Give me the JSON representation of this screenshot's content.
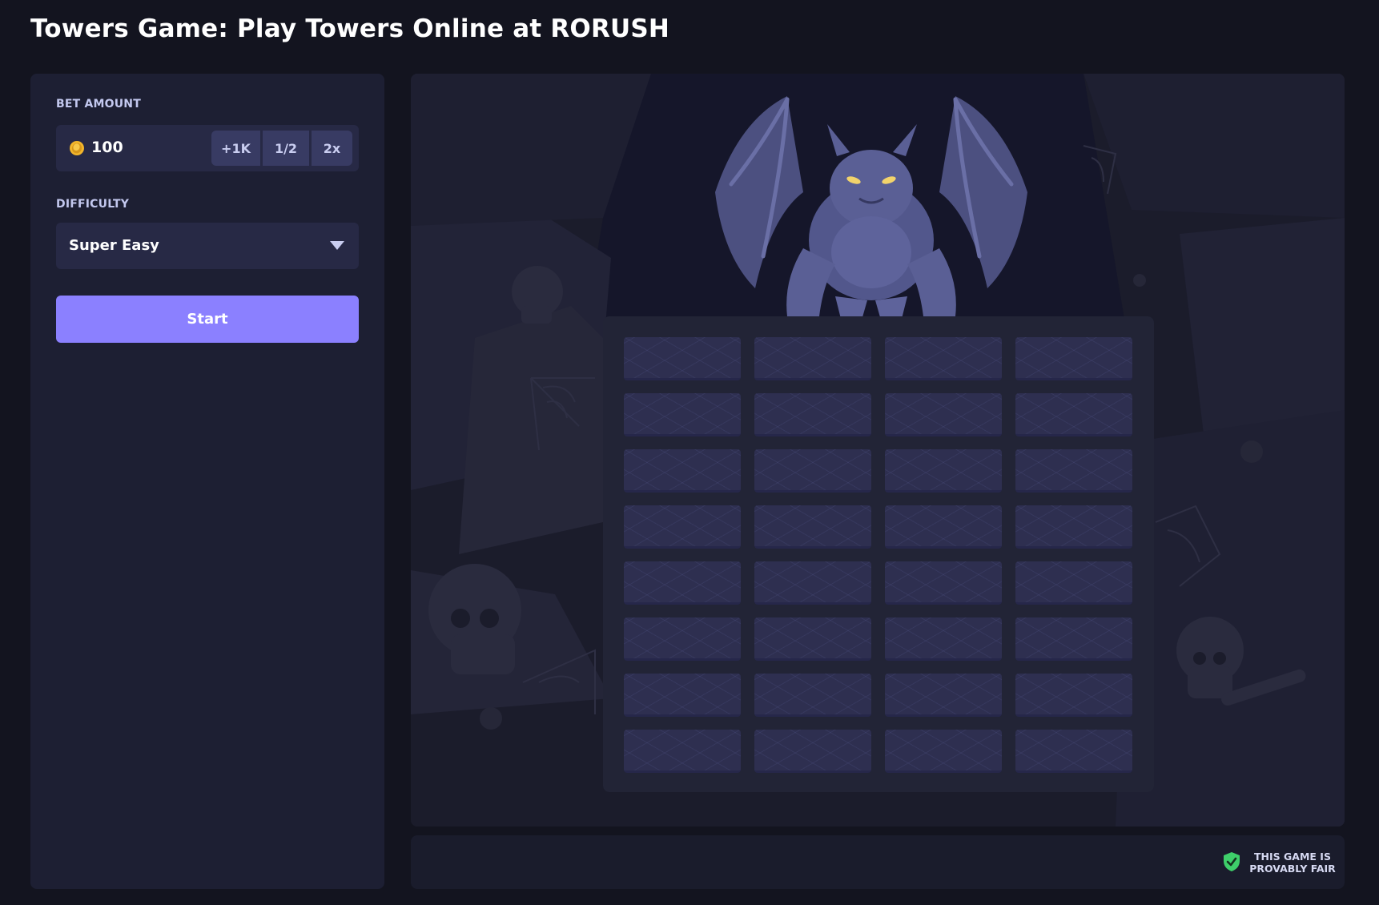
{
  "page": {
    "title": "Towers Game: Play Towers Online at RORUSH"
  },
  "controls": {
    "bet_label": "BET AMOUNT",
    "bet_value": "100",
    "bet_buttons": [
      "+1K",
      "1/2",
      "2x"
    ],
    "difficulty_label": "DIFFICULTY",
    "difficulty_value": "Super Easy",
    "start_label": "Start"
  },
  "board": {
    "rows": 8,
    "columns": 4
  },
  "footer": {
    "fair_line1": "THIS GAME IS",
    "fair_line2": "PROVABLY FAIR"
  },
  "colors": {
    "accent": "#8b80ff",
    "shield": "#3ecf6a",
    "coin": "#f2b52b"
  },
  "icons": {
    "coin": "coin-icon",
    "difficulty_dropdown": "chevron-down-icon",
    "fairness": "shield-icon"
  }
}
